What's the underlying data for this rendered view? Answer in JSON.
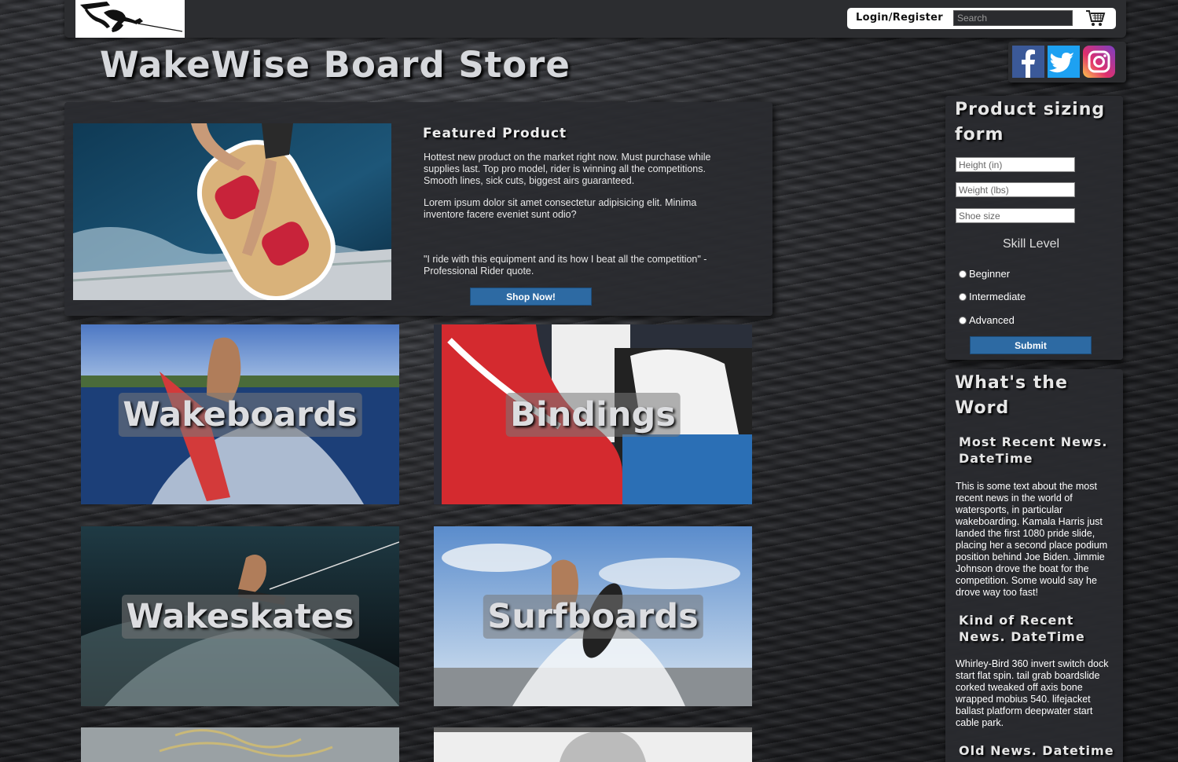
{
  "header": {
    "login_label": "Login/Register",
    "search_placeholder": "Search"
  },
  "site_title": "WakeWise Board Store",
  "featured": {
    "title": "Featured Product",
    "paragraph1": "Hottest new product on the market right now. Must purchase while supplies last. Top pro model, rider is winning all the competitions. Smooth lines, sick cuts, biggest airs guaranteed.",
    "paragraph2": "Lorem ipsum dolor sit amet consectetur adipisicing elit. Minima inventore facere eveniet sunt odio?",
    "quote": "\"I ride with this equipment and its how I beat all the competition\" - Professional Rider quote.",
    "button_label": "Shop Now!"
  },
  "categories": [
    {
      "label": "Wakeboards"
    },
    {
      "label": "Bindings"
    },
    {
      "label": "Wakeskates"
    },
    {
      "label": "Surfboards"
    }
  ],
  "sizing_form": {
    "title": "Product sizing form",
    "height_placeholder": "Height (in)",
    "weight_placeholder": "Weight (lbs)",
    "shoe_placeholder": "Shoe size",
    "skill_label": "Skill Level",
    "options": [
      "Beginner",
      "Intermediate",
      "Advanced"
    ],
    "submit_label": "Submit"
  },
  "news": {
    "title": "What's the Word",
    "items": [
      {
        "heading": "Most Recent News. DateTime",
        "body": "This is some text about the most recent news in the world of watersports, in particular wakeboarding. Kamala Harris just landed the first 1080 pride slide, placing her a second place podium position behind Joe Biden. Jimmie Johnson drove the boat for the competition. Some would say he drove way too fast!"
      },
      {
        "heading": "Kind of Recent News. DateTime",
        "body": "Whirley-Bird 360 invert switch dock start flat spin. tail grab boardslide corked tweaked off axis bone wrapped mobius 540. lifejacket ballast platform deepwater start cable park."
      },
      {
        "heading": "Old News. Datetime",
        "body": ""
      }
    ]
  },
  "icons": {
    "cart": "cart-icon",
    "facebook": "facebook-icon",
    "twitter": "twitter-icon",
    "instagram": "instagram-icon"
  },
  "colors": {
    "accent_button": "#2d6aa3",
    "facebook": "#3b5998",
    "twitter": "#1da1f2"
  }
}
